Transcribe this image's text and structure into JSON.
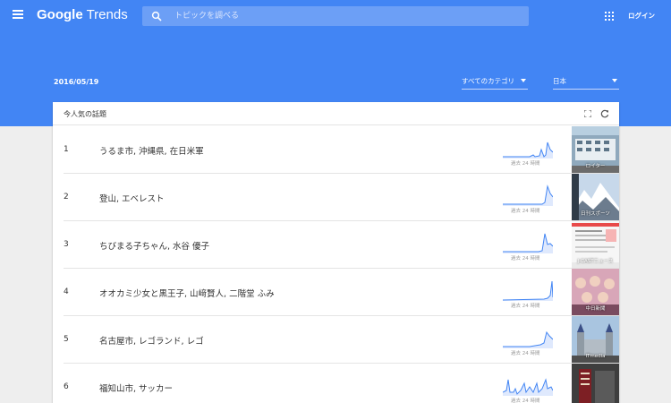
{
  "app": {
    "brand_first": "Google",
    "brand_second": "Trends"
  },
  "topbar": {
    "menu_icon": "hamburger-menu-icon",
    "search_placeholder": "トピックを調べる",
    "apps_icon": "apps-grid-icon",
    "login_label": "ログイン"
  },
  "filters": {
    "date": "2016/05/19",
    "category": "すべてのカテゴリ",
    "country": "日本"
  },
  "card": {
    "title": "今人気の話題",
    "spark_label": "過去 24 時間",
    "rows": [
      {
        "rank": "1",
        "title": "うるま市, 沖縄県, 在日米軍",
        "source": "ロイター"
      },
      {
        "rank": "2",
        "title": "登山, エベレスト",
        "source": "日刊スポーツ"
      },
      {
        "rank": "3",
        "title": "ちびまる子ちゃん, 水谷 優子",
        "source": "J-CASTニュース"
      },
      {
        "rank": "4",
        "title": "オオカミ少女と黒王子, 山﨑賢人, 二階堂 ふみ",
        "source": "中日新聞"
      },
      {
        "rank": "5",
        "title": "名古屋市, レゴランド, レゴ",
        "source": "ITmedia"
      },
      {
        "rank": "6",
        "title": "福知山市, サッカー",
        "source": ""
      }
    ]
  },
  "colors": {
    "header_blue": "#4285f4",
    "spark_line": "#4285f4",
    "background": "#eeeeee"
  }
}
